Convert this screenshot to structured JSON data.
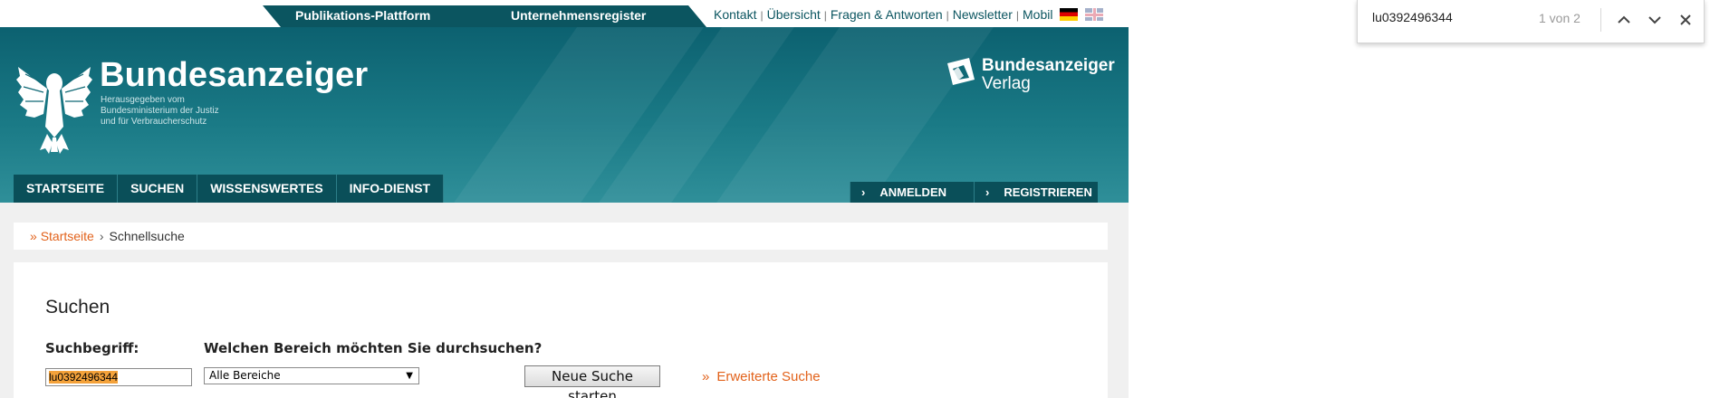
{
  "topbar": {
    "tabs": [
      "Publikations-Plattform",
      "Unternehmensregister"
    ],
    "links": [
      "Kontakt",
      "Übersicht",
      "Fragen & Antworten",
      "Newsletter",
      "Mobil"
    ]
  },
  "header": {
    "title": "Bundesanzeiger",
    "subtitle_lines": [
      "Herausgegeben vom",
      "Bundesministerium der Justiz",
      "und für Verbraucherschutz"
    ],
    "verlag": [
      "Bundesanzeiger",
      "Verlag"
    ]
  },
  "nav": {
    "items": [
      "STARTSEITE",
      "SUCHEN",
      "WISSENSWERTES",
      "INFO-DIENST"
    ],
    "auth": [
      "ANMELDEN",
      "REGISTRIEREN"
    ]
  },
  "breadcrumb": {
    "home": "Startseite",
    "current": "Schnellsuche"
  },
  "search": {
    "title": "Suchen",
    "term_label": "Suchbegriff:",
    "area_label": "Welchen Bereich möchten Sie durchsuchen?",
    "term_value": "lu0392496344",
    "area_value": "Alle Bereiche",
    "submit_label": "Neue Suche starten",
    "advanced_label": "Erweiterte Suche"
  },
  "findbar": {
    "query": "lu0392496344",
    "count": "1 von 2"
  },
  "colors": {
    "brand_teal": "#0c6170",
    "nav_dark": "#0a4f59",
    "link_orange": "#e2621b",
    "find_highlight": "#f4a23a"
  }
}
